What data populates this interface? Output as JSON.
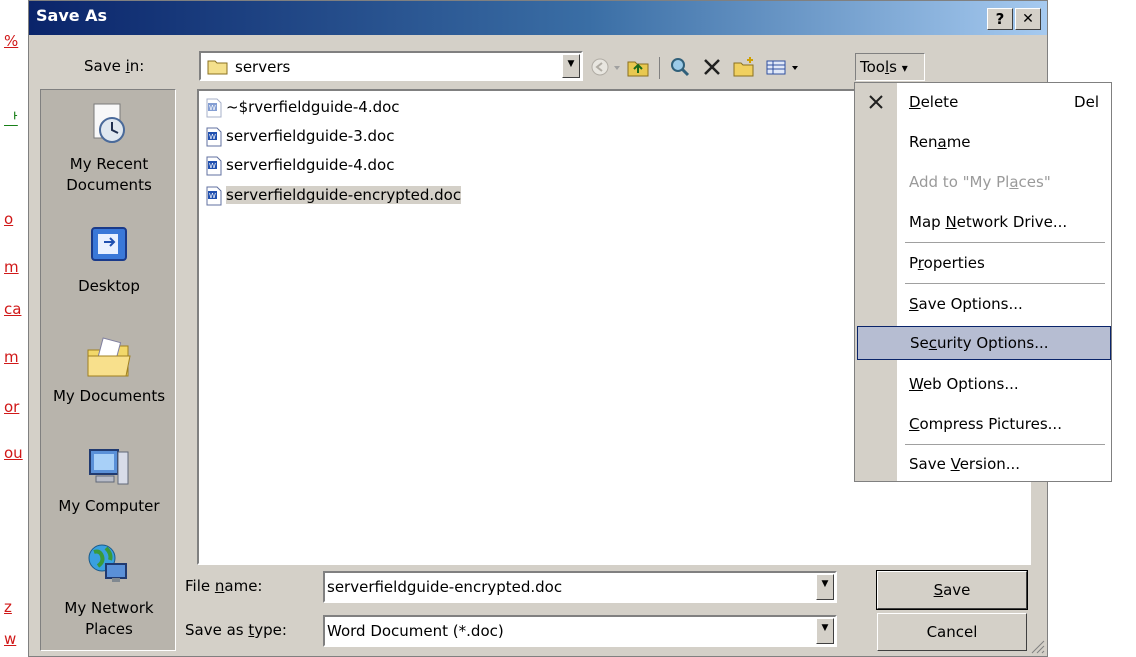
{
  "background_fragments": [
    "%",
    "ᅡ",
    "o",
    "m",
    "ca",
    "m",
    "or",
    "ou",
    "z",
    "w"
  ],
  "dialog": {
    "title": "Save As",
    "help_button": "?",
    "close_button": "✕"
  },
  "save_in": {
    "label_pre": "Save ",
    "label_u": "i",
    "label_post": "n:",
    "value": "servers"
  },
  "toolbar": {
    "tools_label_pre": "Too",
    "tools_label_u": "l",
    "tools_label_post": "s",
    "tools_arrow": "▾"
  },
  "places": [
    {
      "name": "my-recent-documents",
      "label": "My Recent\nDocuments",
      "icon": "recent-documents-icon"
    },
    {
      "name": "desktop",
      "label": "Desktop",
      "icon": "desktop-icon"
    },
    {
      "name": "my-documents",
      "label": "My Documents",
      "icon": "folder-documents-icon"
    },
    {
      "name": "my-computer",
      "label": "My Computer",
      "icon": "computer-icon"
    },
    {
      "name": "my-network-places",
      "label": "My Network\nPlaces",
      "icon": "network-icon"
    }
  ],
  "files": [
    {
      "name": "~$rverfieldguide-4.doc",
      "selected": false
    },
    {
      "name": "serverfieldguide-3.doc",
      "selected": false
    },
    {
      "name": "serverfieldguide-4.doc",
      "selected": false
    },
    {
      "name": "serverfieldguide-encrypted.doc",
      "selected": true
    }
  ],
  "file_name": {
    "label_pre": "File ",
    "label_u": "n",
    "label_post": "ame:",
    "value": "serverfieldguide-encrypted.doc"
  },
  "save_as_type": {
    "label_pre": "Save as ",
    "label_u": "t",
    "label_post": "ype:",
    "value": "Word Document (*.doc)"
  },
  "buttons": {
    "save_pre": "",
    "save_u": "S",
    "save_post": "ave",
    "cancel": "Cancel"
  },
  "tools_menu": [
    {
      "name": "delete",
      "pre": "",
      "u": "D",
      "post": "elete",
      "shortcut": "Del",
      "disabled": false,
      "highlighted": false
    },
    {
      "name": "rename",
      "pre": "Ren",
      "u": "a",
      "post": "me",
      "shortcut": "",
      "disabled": false,
      "highlighted": false
    },
    {
      "name": "add-to-my-places",
      "pre": "Add to \"My Pl",
      "u": "a",
      "post": "ces\"",
      "shortcut": "",
      "disabled": true,
      "highlighted": false
    },
    {
      "name": "map-network-drive",
      "pre": "Map ",
      "u": "N",
      "post": "etwork Drive...",
      "shortcut": "",
      "disabled": false,
      "highlighted": false
    },
    {
      "name": "properties",
      "pre": "P",
      "u": "r",
      "post": "operties",
      "shortcut": "",
      "disabled": false,
      "highlighted": false
    },
    {
      "name": "save-options",
      "pre": "",
      "u": "S",
      "post": "ave Options...",
      "shortcut": "",
      "disabled": false,
      "highlighted": false
    },
    {
      "name": "security-options",
      "pre": "Se",
      "u": "c",
      "post": "urity Options...",
      "shortcut": "",
      "disabled": false,
      "highlighted": true
    },
    {
      "name": "web-options",
      "pre": "",
      "u": "W",
      "post": "eb Options...",
      "shortcut": "",
      "disabled": false,
      "highlighted": false
    },
    {
      "name": "compress-pictures",
      "pre": "",
      "u": "C",
      "post": "ompress Pictures...",
      "shortcut": "",
      "disabled": false,
      "highlighted": false
    },
    {
      "name": "save-version",
      "pre": "Save ",
      "u": "V",
      "post": "ersion...",
      "shortcut": "",
      "disabled": false,
      "highlighted": false
    }
  ],
  "colors": {
    "title_start": "#0a246a",
    "title_end": "#a6caf0",
    "dialog_bg": "#d4d0c8",
    "highlight": "#b6bdd2"
  }
}
